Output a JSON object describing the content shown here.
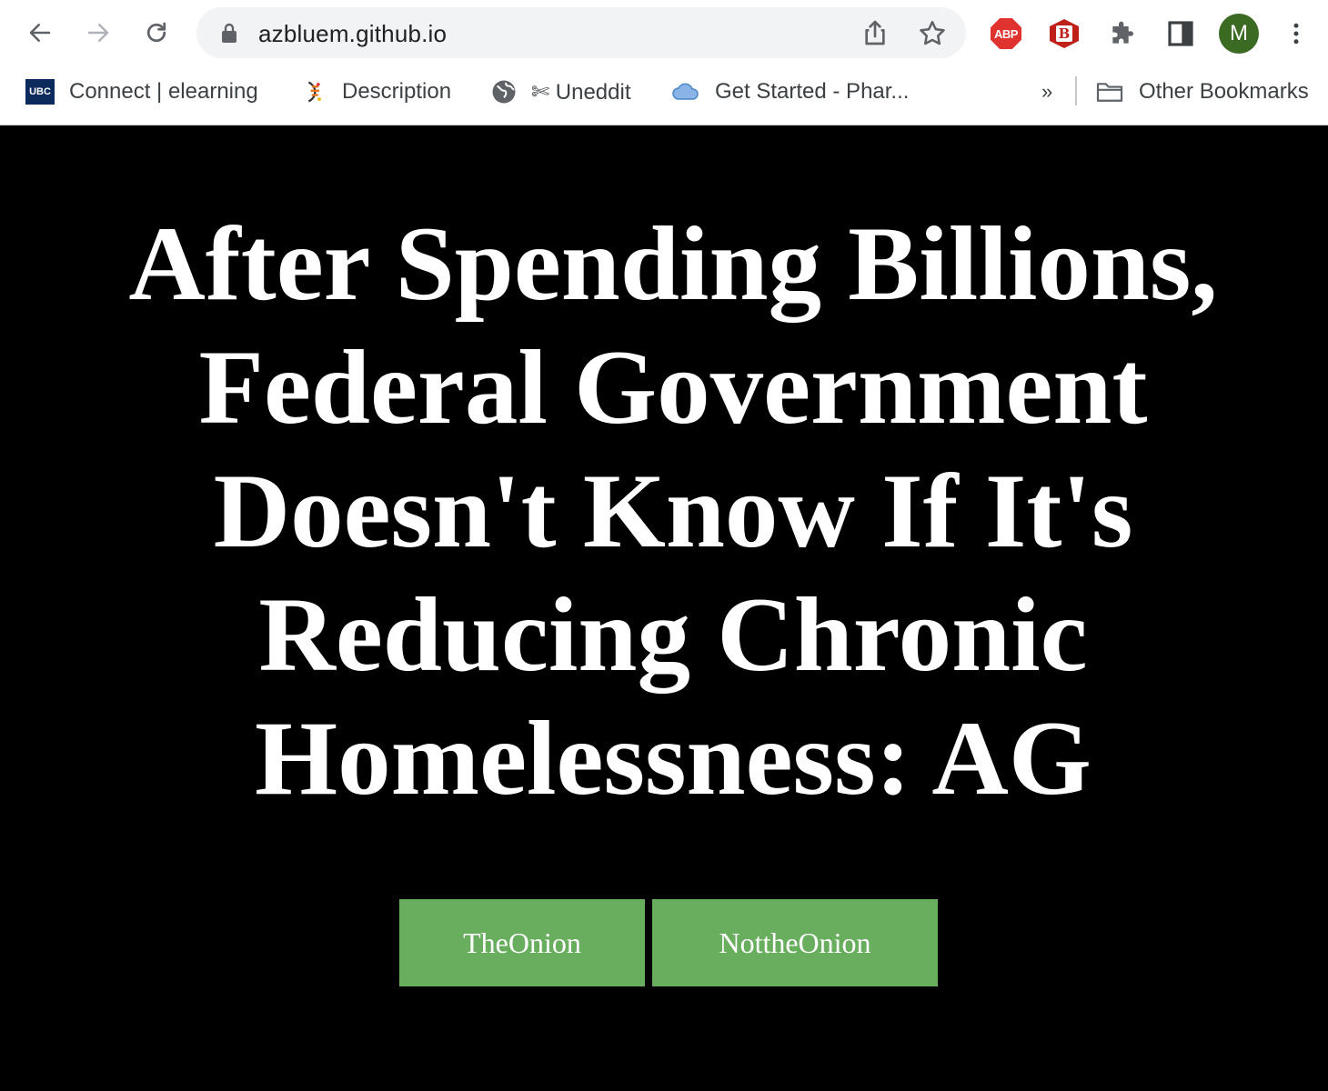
{
  "browser": {
    "url": "azbluem.github.io",
    "profile_initial": "M",
    "extensions": {
      "abp_label": "ABP",
      "b_label": "B"
    },
    "bookmarks": [
      {
        "label": "Connect | elearning",
        "icon": "ubc-icon",
        "icon_text": "UBC"
      },
      {
        "label": "Description",
        "icon": "dna-icon"
      },
      {
        "label": "✄ Uneddit",
        "icon": "globe-icon"
      },
      {
        "label": "Get Started - Phar...",
        "icon": "cloud-icon"
      }
    ],
    "overflow_label": "»",
    "other_bookmarks": "Other Bookmarks"
  },
  "page": {
    "headline": "After Spending Billions, Federal Government Doesn't Know If It's Reducing Chronic Homelessness: AG",
    "buttons": {
      "the_onion": "TheOnion",
      "not_the_onion": "NottheOnion"
    }
  },
  "colors": {
    "page_background": "#000000",
    "headline": "#ffffff",
    "button_background": "#69ae5e",
    "button_text": "#ffffff",
    "avatar": "#3b6b22"
  }
}
